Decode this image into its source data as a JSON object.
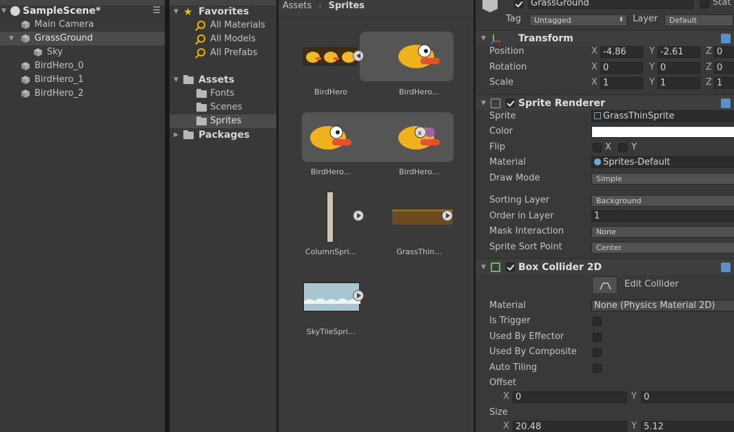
{
  "hierarchy": {
    "scene": "SampleScene*",
    "items": [
      {
        "label": "Main Camera"
      },
      {
        "label": "GrassGround"
      },
      {
        "label": "Sky"
      },
      {
        "label": "BirdHero_0"
      },
      {
        "label": "BirdHero_1"
      },
      {
        "label": "BirdHero_2"
      }
    ]
  },
  "project": {
    "favorites": "Favorites",
    "fav_items": [
      "All Materials",
      "All Models",
      "All Prefabs"
    ],
    "assets": "Assets",
    "asset_folders": [
      "Fonts",
      "Scenes",
      "Sprites"
    ],
    "packages": "Packages"
  },
  "browser": {
    "breadcrumb": [
      "Assets",
      "Sprites"
    ],
    "items": [
      {
        "label": "BirdHero"
      },
      {
        "label": "BirdHero..."
      },
      {
        "label": "BirdHero..."
      },
      {
        "label": "BirdHero..."
      },
      {
        "label": "ColumnSpri..."
      },
      {
        "label": "GrassThin..."
      },
      {
        "label": "SkyTileSpri..."
      }
    ]
  },
  "inspector": {
    "object_name": "GrassGround",
    "static_label": "Stat",
    "tag_label": "Tag",
    "tag_value": "Untagged",
    "layer_label": "Layer",
    "layer_value": "Default",
    "transform": {
      "title": "Transform",
      "position_label": "Position",
      "rotation_label": "Rotation",
      "scale_label": "Scale",
      "axes": [
        "X",
        "Y",
        "Z"
      ],
      "position": [
        "-4.86",
        "-2.61",
        "0"
      ],
      "rotation": [
        "0",
        "0",
        "0"
      ],
      "scale": [
        "1",
        "1",
        "1"
      ]
    },
    "sprite_renderer": {
      "title": "Sprite Renderer",
      "sprite_label": "Sprite",
      "sprite_value": "GrassThinSprite",
      "color_label": "Color",
      "color_value": "#ffffff",
      "flip_label": "Flip",
      "flip_x": "X",
      "flip_y": "Y",
      "material_label": "Material",
      "material_value": "Sprites-Default",
      "draw_mode_label": "Draw Mode",
      "draw_mode_value": "Simple",
      "sorting_layer_label": "Sorting Layer",
      "sorting_layer_value": "Background",
      "order_label": "Order in Layer",
      "order_value": "1",
      "mask_label": "Mask Interaction",
      "mask_value": "None",
      "sort_point_label": "Sprite Sort Point",
      "sort_point_value": "Center"
    },
    "box_collider": {
      "title": "Box Collider 2D",
      "edit_label": "Edit Collider",
      "material_label": "Material",
      "material_value": "None (Physics Material 2D)",
      "is_trigger_label": "Is Trigger",
      "used_by_effector_label": "Used By Effector",
      "used_by_composite_label": "Used By Composite",
      "auto_tiling_label": "Auto Tiling",
      "offset_label": "Offset",
      "offset_x": "0",
      "offset_y": "0",
      "size_label": "Size",
      "size_x": "20.48",
      "size_y": "5.12",
      "x": "X",
      "y": "Y"
    }
  }
}
